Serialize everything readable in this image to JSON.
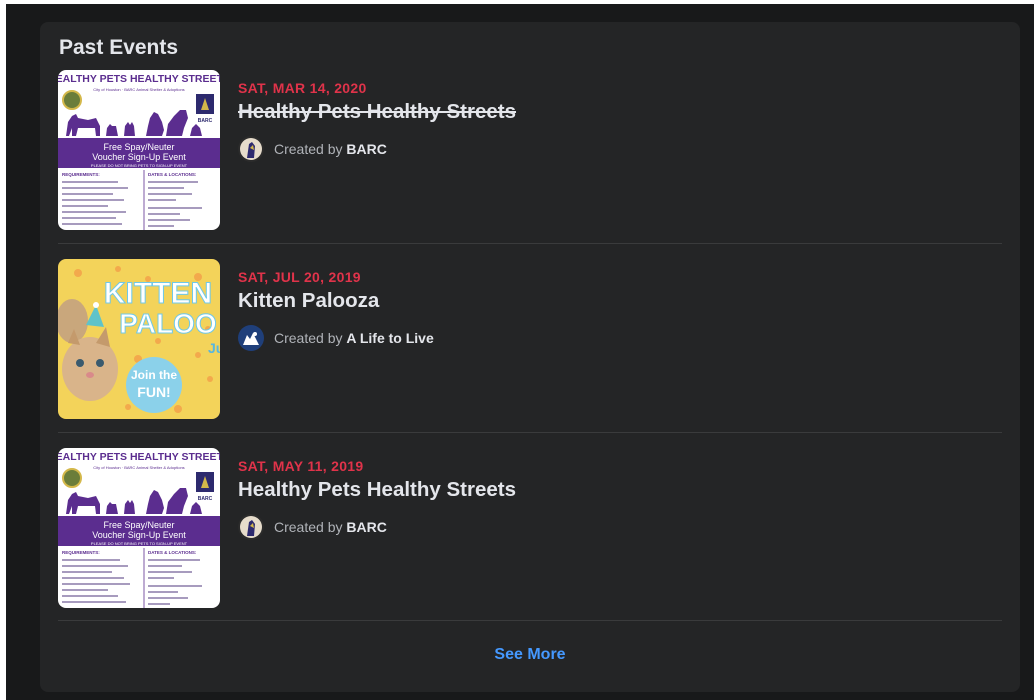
{
  "section": {
    "title": "Past Events"
  },
  "events": [
    {
      "date": "SAT, MAR 14, 2020",
      "name": "Healthy Pets Healthy Streets",
      "created_prefix": "Created by",
      "creator": "BARC",
      "struck": true,
      "poster": {
        "header": "HEALTHY PETS HEALTHY STREETS",
        "sub": "City of Houston · BARC Animal Shelter & Adoptions",
        "logo": "BARC",
        "band1": "Free Spay/Neuter",
        "band2": "Voucher Sign-Up Event",
        "band3": "PLEASE DO NOT BRING PETS TO SIGN-UP EVENT",
        "left_head": "REQUIREMENTS:",
        "right_head": "DATES & LOCATIONS:"
      }
    },
    {
      "date": "SAT, JUL 20, 2019",
      "name": "Kitten Palooza",
      "created_prefix": "Created by",
      "creator": "A Life to Live",
      "struck": false,
      "poster": {
        "line1": "KITTEN",
        "line2": "PALOO",
        "badge1": "Join the",
        "badge2": "FUN!",
        "corner": "Ju"
      }
    },
    {
      "date": "SAT, MAY 11, 2019",
      "name": "Healthy Pets Healthy Streets",
      "created_prefix": "Created by",
      "creator": "BARC",
      "struck": false,
      "poster": {
        "header": "HEALTHY PETS HEALTHY STREETS",
        "sub": "City of Houston · BARC Animal Shelter & Adoptions",
        "logo": "BARC",
        "band1": "Free Spay/Neuter",
        "band2": "Voucher Sign-Up Event",
        "band3": "PLEASE DO NOT BRING PETS TO SIGN-UP EVENT",
        "left_head": "REQUIREMENTS:",
        "right_head": "DATES & LOCATIONS:"
      }
    }
  ],
  "see_more": "See More",
  "colors": {
    "date": "#e0334a",
    "link": "#4599ff",
    "card": "#242526",
    "poster_purple": "#5b2d8f"
  }
}
